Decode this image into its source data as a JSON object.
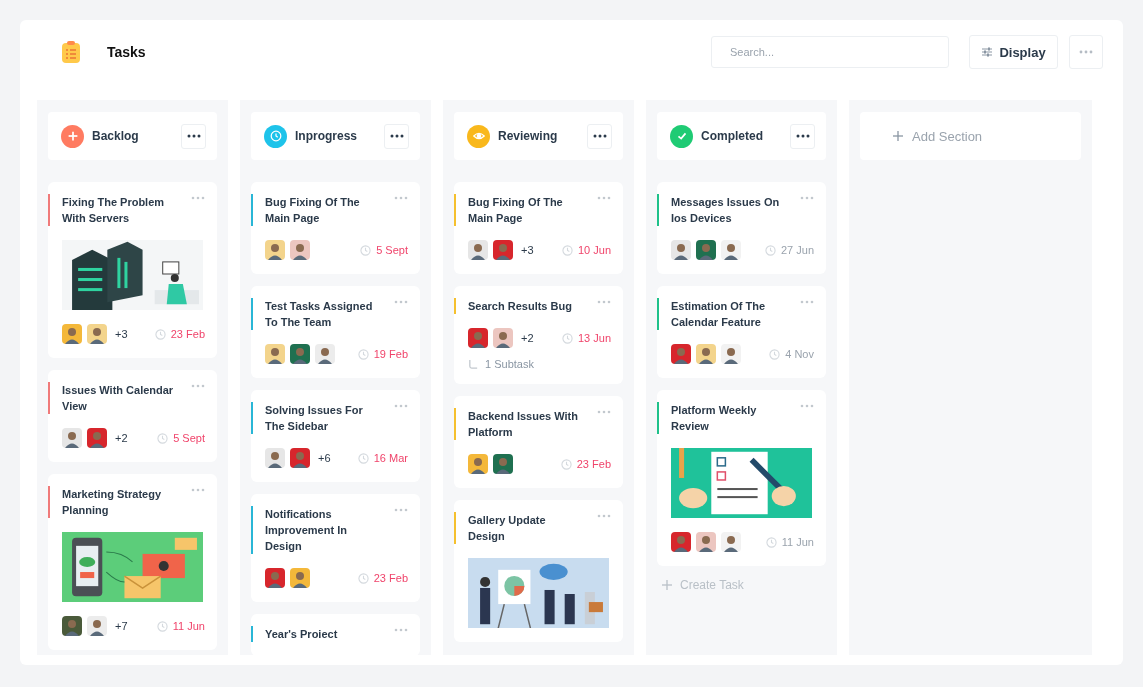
{
  "header": {
    "title": "Tasks",
    "search": {
      "placeholder": "Search..."
    },
    "display_button": "Display"
  },
  "sections": [
    {
      "kind": "backlog",
      "title": "Backlog",
      "cards": [
        {
          "title": "Fixing The Problem With Servers",
          "picture": {
            "kind": "picture"
          },
          "avatars": [
            {
              "color": "#f4b83a"
            },
            {
              "color": "#f3d48c"
            }
          ],
          "extra": "+3",
          "date": "23 Feb"
        },
        {
          "title": "Issues With Calendar View",
          "avatars": [
            {
              "color": "#e6e6e6"
            },
            {
              "color": "#d7262c"
            }
          ],
          "extra": "+2",
          "date": "5 Sept"
        },
        {
          "title": "Marketing Strategy Planning",
          "picture": {
            "kind": "picture"
          },
          "avatars": [
            {
              "color": "#4a5a3a"
            },
            {
              "color": "#ececec"
            }
          ],
          "extra": "+7",
          "date": "11 Jun"
        }
      ]
    },
    {
      "kind": "inprogress",
      "title": "Inprogress",
      "cards": [
        {
          "title": "Bug Fixing Of The Main Page",
          "avatars": [
            {
              "color": "#f3d48c"
            },
            {
              "color": "#ecc6c0"
            }
          ],
          "date": "5 Sept"
        },
        {
          "title": "Test Tasks Assigned To The Team",
          "avatars": [
            {
              "color": "#f3d48c"
            },
            {
              "color": "#1f7050"
            },
            {
              "color": "#ececec"
            }
          ],
          "date": "19 Feb"
        },
        {
          "title": "Solving Issues For The Sidebar",
          "avatars": [
            {
              "color": "#e6e6e6"
            },
            {
              "color": "#d7262c"
            }
          ],
          "extra": "+6",
          "date": "16 Mar"
        },
        {
          "title": "Notifications Improvement In Design",
          "avatars": [
            {
              "color": "#d7262c"
            },
            {
              "color": "#f4b83a"
            }
          ],
          "date": "23 Feb"
        },
        {
          "title": "Year's Proiect"
        }
      ]
    },
    {
      "kind": "reviewing",
      "title": "Reviewing",
      "cards": [
        {
          "title": "Bug Fixing Of The Main Page",
          "avatars": [
            {
              "color": "#e6e6e6"
            },
            {
              "color": "#d7262c"
            }
          ],
          "extra": "+3",
          "date": "10 Jun"
        },
        {
          "title": "Search Results Bug",
          "avatars": [
            {
              "color": "#d7262c"
            },
            {
              "color": "#ecc6c0"
            }
          ],
          "extra": "+2",
          "date": "13 Jun",
          "subtask": "1 Subtask"
        },
        {
          "title": "Backend Issues With Platform",
          "avatars": [
            {
              "color": "#f4b83a"
            },
            {
              "color": "#1f7050"
            }
          ],
          "date": "23 Feb"
        },
        {
          "title": "Gallery Update Design",
          "picture": {
            "kind": "picture"
          }
        }
      ]
    },
    {
      "kind": "completed",
      "title": "Completed",
      "cards": [
        {
          "title": "Messages Issues On Ios Devices",
          "avatars": [
            {
              "color": "#e6e6e6"
            },
            {
              "color": "#1f7050"
            },
            {
              "color": "#f2f2f2"
            }
          ],
          "date": "27 Jun"
        },
        {
          "title": "Estimation Of The Calendar Feature",
          "avatars": [
            {
              "color": "#d7262c"
            },
            {
              "color": "#f3d48c"
            },
            {
              "color": "#f2f2f2"
            }
          ],
          "date": "4 Nov"
        },
        {
          "title": "Platform Weekly Review",
          "picture": {
            "kind": "picture"
          },
          "avatars": [
            {
              "color": "#d7262c"
            },
            {
              "color": "#ecc6c0"
            },
            {
              "color": "#f2f2f2"
            }
          ],
          "date": "11 Jun"
        }
      ],
      "create_task": "Create Task"
    }
  ],
  "add_section": "Add Section"
}
